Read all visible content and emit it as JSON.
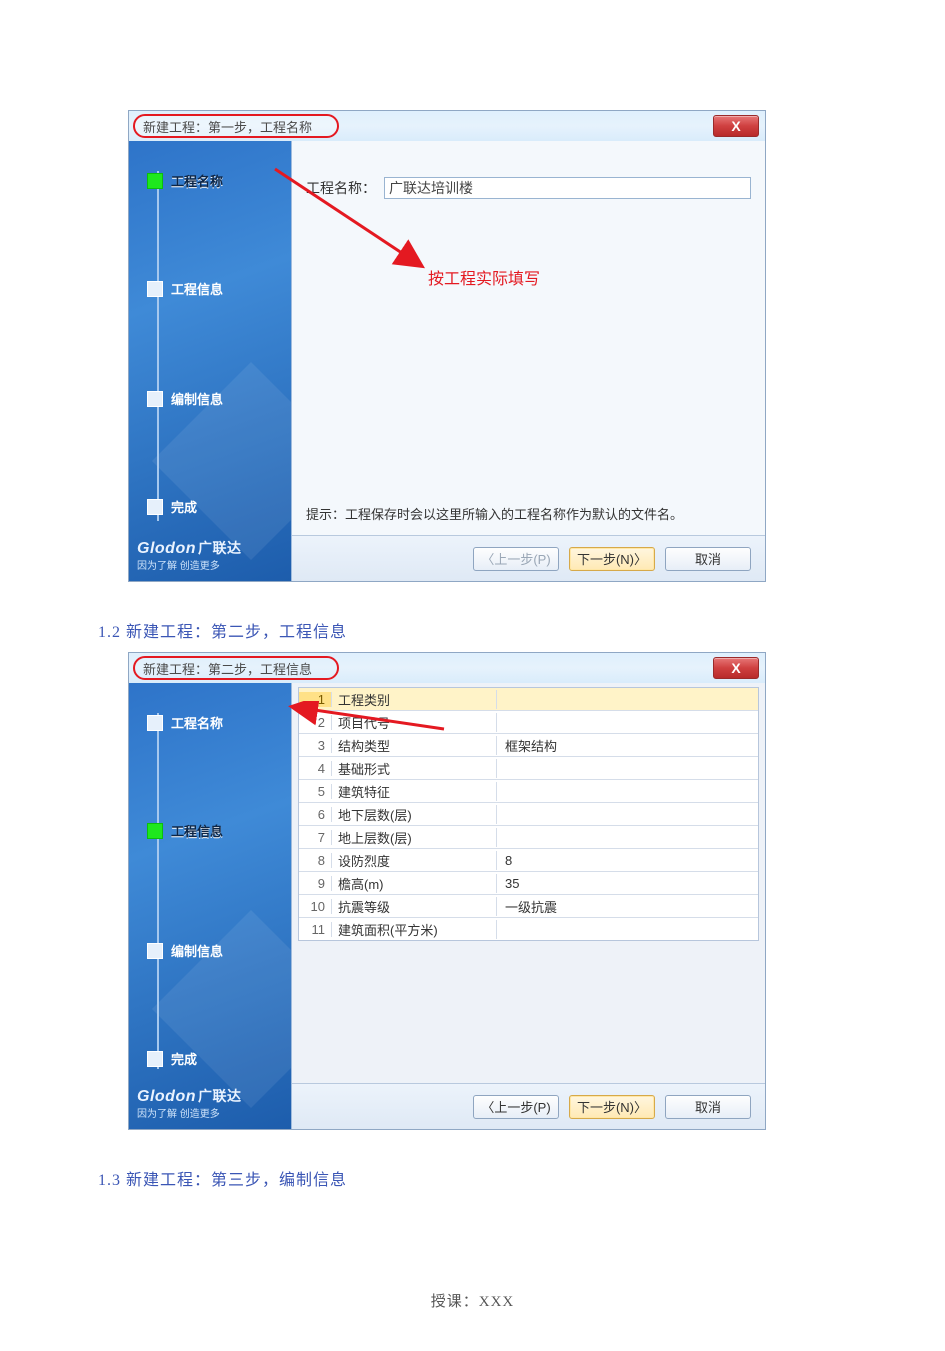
{
  "dialog1": {
    "title": "新建工程：第一步，工程名称",
    "close_x": "X",
    "steps": [
      "工程名称",
      "工程信息",
      "编制信息",
      "完成"
    ],
    "active_step": 0,
    "brand_line1": "Glodon",
    "brand_line1_cn": "广联达",
    "brand_line2": "因为了解  创造更多",
    "field_label": "工程名称：",
    "field_value": "广联达培训楼",
    "annotation": "按工程实际填写",
    "hint": "提示：工程保存时会以这里所输入的工程名称作为默认的文件名。",
    "buttons": {
      "prev": "〈上一步(P)",
      "next": "下一步(N)〉",
      "cancel": "取消"
    }
  },
  "section_1_2": "1.2 新建工程：第二步，工程信息",
  "dialog2": {
    "title": "新建工程：第二步，工程信息",
    "close_x": "X",
    "steps": [
      "工程名称",
      "工程信息",
      "编制信息",
      "完成"
    ],
    "active_step": 1,
    "brand_line1": "Glodon",
    "brand_line1_cn": "广联达",
    "brand_line2": "因为了解  创造更多",
    "rows": [
      {
        "n": "1",
        "name": "工程类别",
        "val": ""
      },
      {
        "n": "2",
        "name": "项目代号",
        "val": ""
      },
      {
        "n": "3",
        "name": "结构类型",
        "val": "框架结构"
      },
      {
        "n": "4",
        "name": "基础形式",
        "val": ""
      },
      {
        "n": "5",
        "name": "建筑特征",
        "val": ""
      },
      {
        "n": "6",
        "name": "地下层数(层)",
        "val": ""
      },
      {
        "n": "7",
        "name": "地上层数(层)",
        "val": ""
      },
      {
        "n": "8",
        "name": "设防烈度",
        "val": "8"
      },
      {
        "n": "9",
        "name": "檐高(m)",
        "val": "35"
      },
      {
        "n": "10",
        "name": "抗震等级",
        "val": "一级抗震"
      },
      {
        "n": "11",
        "name": "建筑面积(平方米)",
        "val": ""
      }
    ],
    "buttons": {
      "prev": "〈上一步(P)",
      "next": "下一步(N)〉",
      "cancel": "取消"
    }
  },
  "section_1_3": "1.3 新建工程：第三步，编制信息",
  "footer": "授课：XXX"
}
